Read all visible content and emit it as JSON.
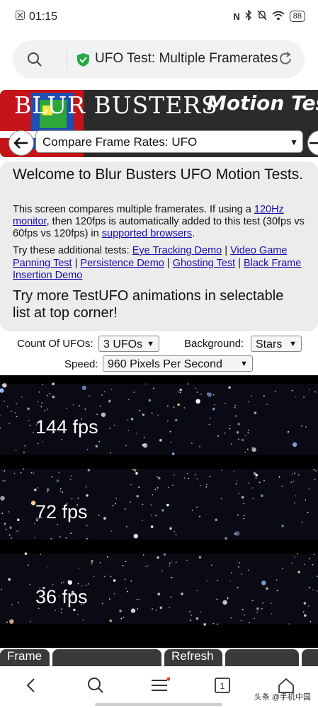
{
  "status": {
    "time": "01:15",
    "battery": "88"
  },
  "urlbar": {
    "title": "UFO Test: Multiple Framerates"
  },
  "banner": {
    "brand": "BLUR  BUSTERS",
    "subtitle": "Motion Tests",
    "selected_test": "Compare Frame Rates: UFO"
  },
  "card": {
    "heading": "Welcome to Blur Busters UFO Motion Tests.",
    "p1_a": "This screen compares multiple framerates. If using a ",
    "p1_link": "120Hz monitor",
    "p1_b": ", then 120fps is automatically added to this test (30fps vs 60fps vs 120fps) in ",
    "p1_link2": "supported browsers",
    "p1_c": ".",
    "p2_a": "Try these additional tests: ",
    "links": [
      "Eye Tracking Demo",
      "Video Game Panning Test",
      "Persistence Demo",
      "Ghosting Test",
      "Black Frame Insertion Demo"
    ],
    "pipe": " | ",
    "more": "Try more TestUFO animations in selectable list at top corner!"
  },
  "controls": {
    "count_label": "Count Of UFOs:",
    "count_value": "3 UFOs",
    "background_label": "Background:",
    "background_value": "Stars",
    "speed_label": "Speed:",
    "speed_value": "960 Pixels Per Second"
  },
  "bands": [
    "144 fps",
    "72 fps",
    "36 fps"
  ],
  "bottom_row": {
    "frame_label": "Frame",
    "refresh_label": "Refresh"
  },
  "watermark": "头条 @手机中国",
  "tab_count": "1"
}
